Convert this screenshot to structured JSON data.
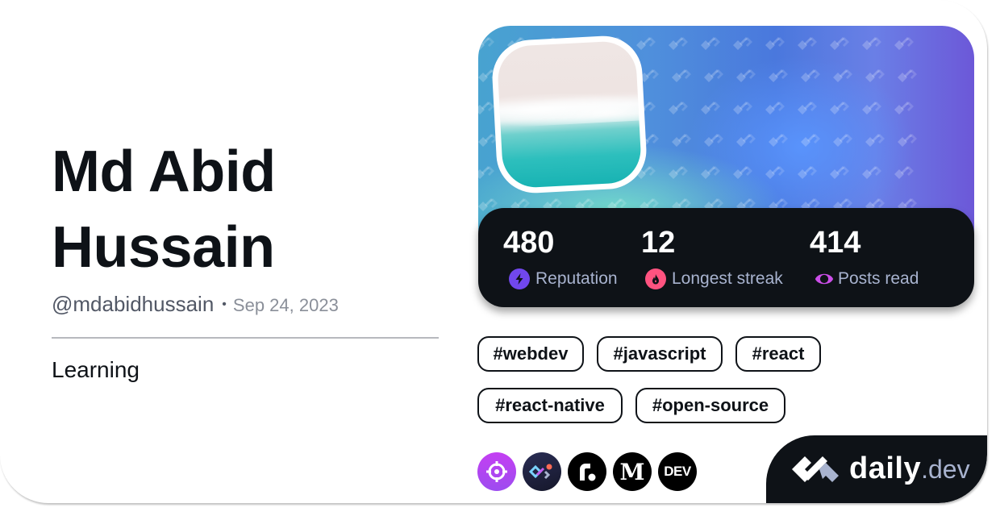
{
  "profile": {
    "name": "Md Abid Hussain",
    "handle": "@mdabidhussain",
    "separator": "•",
    "joined": "Sep 24, 2023",
    "bio": "Learning"
  },
  "cover": {
    "pattern_icon": "daily-dev-logo-icon",
    "avatar_image": "beach-shoreline-avatar"
  },
  "stats": [
    {
      "value": "480",
      "label": "Reputation",
      "icon": "lightning-icon",
      "color": "#7147ed"
    },
    {
      "value": "12",
      "label": "Longest streak",
      "icon": "flame-icon",
      "color": "#ff5380"
    },
    {
      "value": "414",
      "label": "Posts read",
      "icon": "eye-ring-icon",
      "color": "#cb4ee8"
    }
  ],
  "tags": [
    "#webdev",
    "#javascript",
    "#react",
    "#react-native",
    "#open-source"
  ],
  "sources": [
    {
      "name": "target-source",
      "icon": "crosshair-icon",
      "color": "#b83cf4"
    },
    {
      "name": "daily-dev-source",
      "icon": "daily-dev-icon",
      "color": "#1c1f3a"
    },
    {
      "name": "r-source",
      "icon": "r-dot-icon",
      "color": "#000000",
      "text": "r."
    },
    {
      "name": "medium-source",
      "icon": "medium-icon",
      "color": "#000000",
      "text": "M"
    },
    {
      "name": "dev-to-source",
      "icon": "dev-icon",
      "color": "#000000",
      "text": "DEV"
    }
  ],
  "brand": {
    "name": "daily",
    "tld": ".dev"
  }
}
